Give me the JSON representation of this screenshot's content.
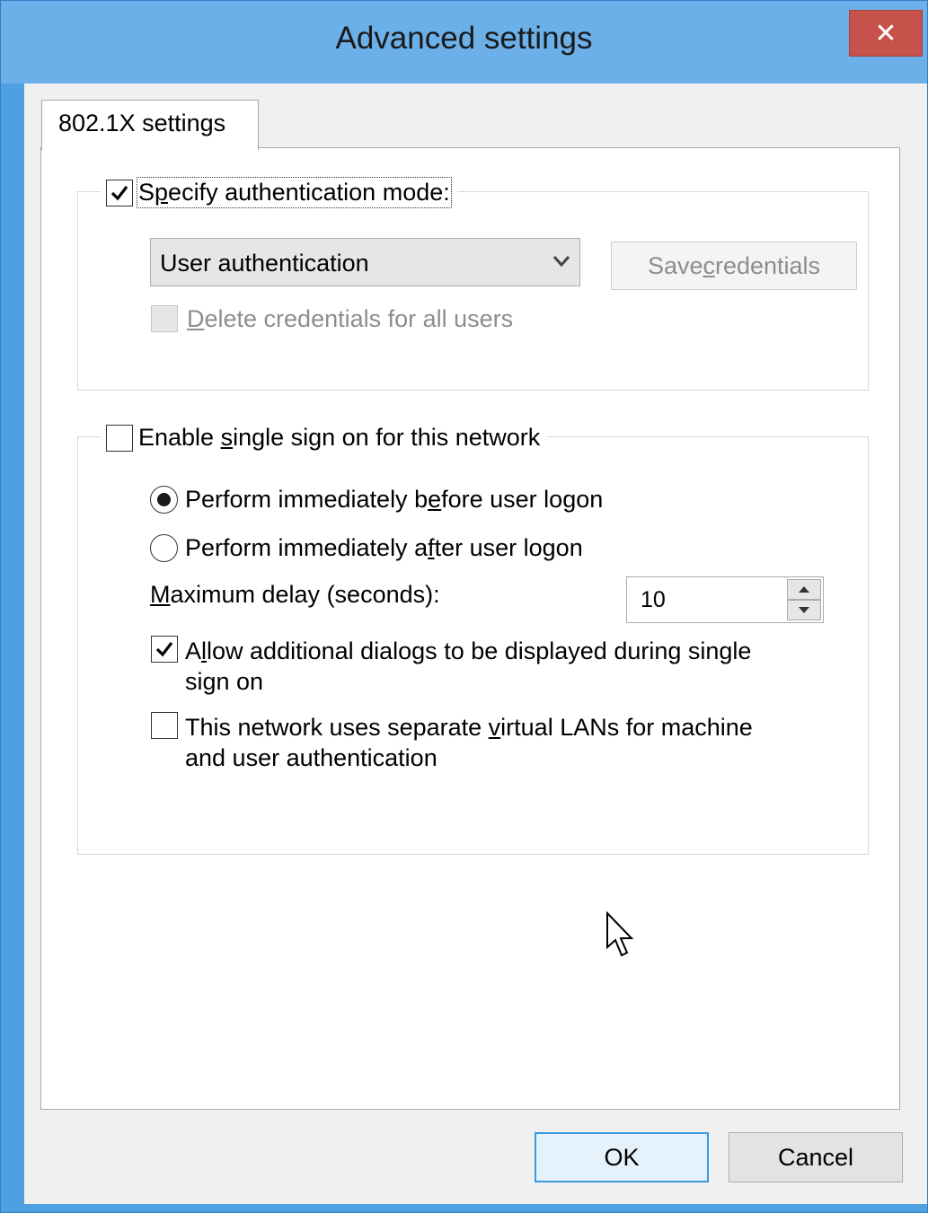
{
  "window": {
    "title": "Advanced settings",
    "close_glyph": "✕"
  },
  "tabs": [
    {
      "label": "802.1X settings"
    }
  ],
  "auth_group": {
    "specify_label_pre": "S",
    "specify_label_u": "p",
    "specify_label_post": "ecify authentication mode:",
    "specify_checked": true,
    "mode_select_value": "User authentication",
    "save_credentials_pre": "Save ",
    "save_credentials_u": "c",
    "save_credentials_post": "redentials",
    "delete_credentials_u": "D",
    "delete_credentials_post": "elete credentials for all users",
    "delete_credentials_checked": false
  },
  "sso_group": {
    "enable_pre": "Enable ",
    "enable_u": "s",
    "enable_post": "ingle sign on for this network",
    "enable_checked": false,
    "radio_before_pre": "Perform immediately b",
    "radio_before_u": "e",
    "radio_before_post": "fore user logon",
    "radio_before_selected": true,
    "radio_after_pre": "Perform immediately a",
    "radio_after_u": "f",
    "radio_after_post": "ter user logon",
    "radio_after_selected": false,
    "max_delay_u": "M",
    "max_delay_post": "aximum delay (seconds):",
    "max_delay_value": "10",
    "allow_dialogs_pre": "A",
    "allow_dialogs_u": "l",
    "allow_dialogs_post_line1": "low additional dialogs to be displayed during single",
    "allow_dialogs_line2": "sign on",
    "allow_dialogs_checked": true,
    "vlan_pre": "This network uses separate ",
    "vlan_u": "v",
    "vlan_post_line1": "irtual LANs for machine",
    "vlan_line2": "and user authentication",
    "vlan_checked": false
  },
  "footer": {
    "ok_label": "OK",
    "cancel_label": "Cancel"
  },
  "icons": {
    "close": "close-icon",
    "checkmark": "checkmark-icon",
    "dropdown": "chevron-down-icon",
    "spin_up": "arrow-up-icon",
    "spin_down": "arrow-down-icon",
    "cursor": "mouse-pointer-icon"
  },
  "colors": {
    "titlebar": "#6cb0ea",
    "close_button": "#c7514b",
    "ok_border": "#3c9ae0"
  }
}
